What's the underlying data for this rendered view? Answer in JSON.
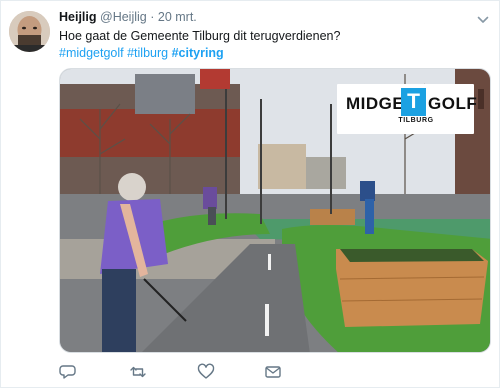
{
  "tweet": {
    "author_name": "Heijlig",
    "author_handle": "@Heijlig",
    "separator": "·",
    "date": "20 mrt.",
    "text": "Hoe gaat de Gemeente Tilburg dit terugverdienen?",
    "hashtags": [
      "#midgetgolf",
      "#tilburg",
      "#cityring"
    ]
  },
  "media": {
    "logo_word_left": "MIDGE",
    "logo_letter": "T",
    "logo_word_right": "GOLF",
    "logo_subtitle": "TILBURG"
  },
  "actions": {
    "icons": [
      "reply-icon",
      "retweet-icon",
      "like-icon",
      "message-icon"
    ]
  },
  "colors": {
    "link": "#1da1f2",
    "secondary_text": "#657786",
    "logo_accent": "#1ba1e2",
    "turf": "#4f9e3a"
  }
}
